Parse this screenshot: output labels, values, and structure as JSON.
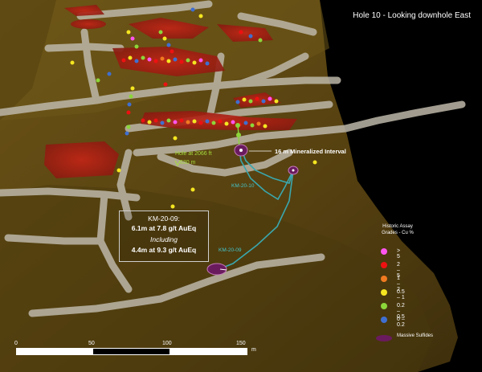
{
  "view": {
    "title": "Hole 10 - Looking downhole East"
  },
  "callout": {
    "hole": "KM-20-09:",
    "result1": "6.1m at 7.8 g/t AuEq",
    "including": "Including",
    "result2": "4.4m at 9.3 g/t AuEq"
  },
  "hole_depth": {
    "feet": "Hole at 2066 ft",
    "meters": "630 m"
  },
  "interval_label": "16 m Mineralized Interval",
  "drillholes": [
    {
      "id": "KM-20-10",
      "color": "#3aa7ad"
    },
    {
      "id": "KM-20-09",
      "color": "#3aa7ad"
    }
  ],
  "legend": {
    "title_lines": [
      "Historic Assay",
      "Grades - Cu %"
    ],
    "items": [
      {
        "label": "> 5",
        "color": "#ff55ee"
      },
      {
        "label": "2 – 5",
        "color": "#ee1111"
      },
      {
        "label": "1 – 2",
        "color": "#f07a20"
      },
      {
        "label": "0.5 – 1",
        "color": "#f5e621"
      },
      {
        "label": "0.2 – 0.5",
        "color": "#8cd63a"
      },
      {
        "label": "0 – 0.2",
        "color": "#3f6fd0"
      }
    ],
    "massive": {
      "label": "Massive Sulfides",
      "color": "#6a1b5e"
    }
  },
  "scale": {
    "ticks": [
      "0",
      "50",
      "100",
      "150"
    ],
    "unit": "m"
  },
  "colors": {
    "host_rock": "#5a4412",
    "workings": "#bdb7a8",
    "mineralization": "#b81f14",
    "background": "#000000"
  }
}
